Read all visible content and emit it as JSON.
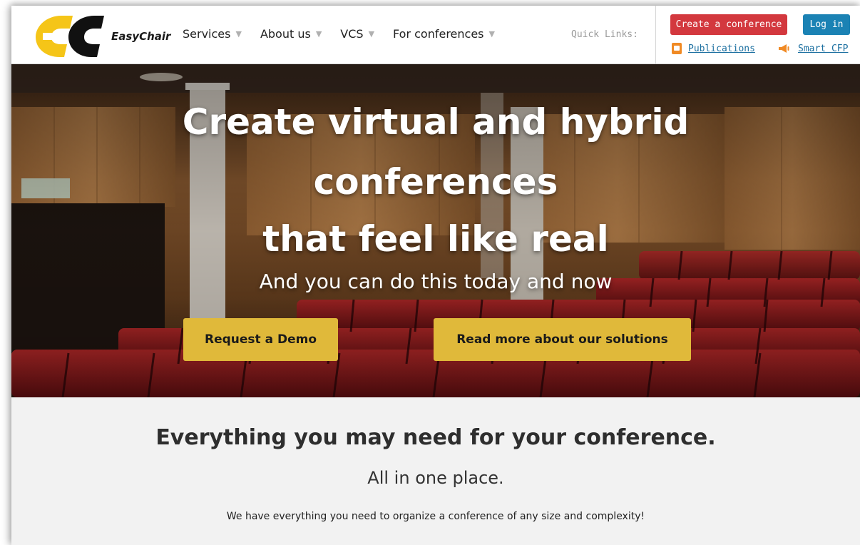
{
  "header": {
    "logo_text": "EasyChair",
    "nav": [
      {
        "label": "Services"
      },
      {
        "label": "About us"
      },
      {
        "label": "VCS"
      },
      {
        "label": "For conferences"
      }
    ],
    "quick_links_label": "Quick Links:",
    "create_button": "Create a conference",
    "login_button": "Log in",
    "publications_link": "Publications",
    "smart_cfp_link": "Smart CFP"
  },
  "hero": {
    "title_line1": "Create virtual and hybrid",
    "title_line2": "conferences",
    "title_line3": "that feel like real",
    "subtitle": "And you can do this today and now",
    "demo_button": "Request a Demo",
    "read_button": "Read more about our solutions"
  },
  "section": {
    "title": "Everything you may need for your conference.",
    "subtitle": "All in one place.",
    "body": "We have everything you need to organize a conference of any size and complexity!"
  },
  "colors": {
    "create_button_bg": "#d3383e",
    "login_button_bg": "#1b82b4",
    "hero_button_bg": "#e0b93a",
    "link": "#1b6fa0",
    "logo_yellow": "#f5c518"
  }
}
